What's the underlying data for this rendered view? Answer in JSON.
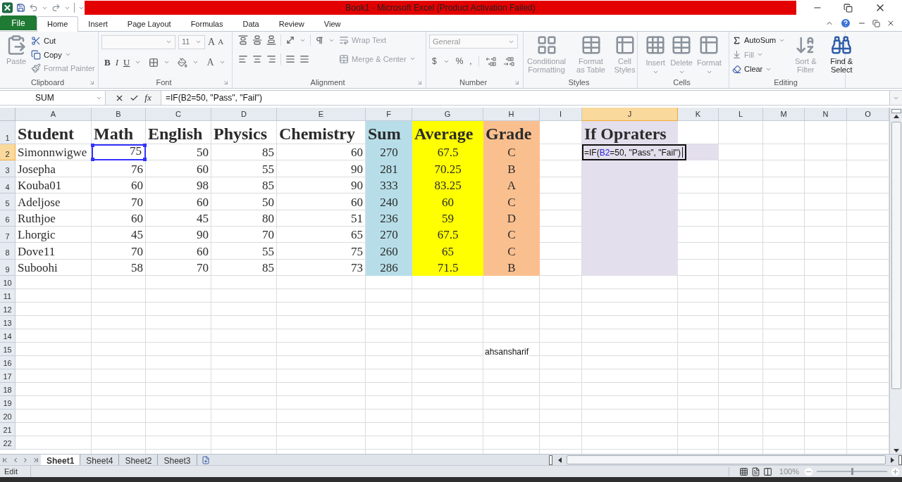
{
  "window": {
    "title": "Book1  -  Microsoft Excel (Product Activation Failed)"
  },
  "ribbon_tabs": [
    {
      "label": "File",
      "kind": "file",
      "selected": false
    },
    {
      "label": "Home",
      "kind": "tab",
      "selected": true
    },
    {
      "label": "Insert",
      "kind": "tab",
      "selected": false
    },
    {
      "label": "Page Layout",
      "kind": "tab",
      "selected": false
    },
    {
      "label": "Formulas",
      "kind": "tab",
      "selected": false
    },
    {
      "label": "Data",
      "kind": "tab",
      "selected": false
    },
    {
      "label": "Review",
      "kind": "tab",
      "selected": false
    },
    {
      "label": "View",
      "kind": "tab",
      "selected": false
    }
  ],
  "ribbon_groups": [
    {
      "kind": "clipboard",
      "label": "Clipboard",
      "commands": [
        {
          "label": "Paste",
          "disabled": true
        },
        {
          "label": "Cut",
          "disabled": false
        },
        {
          "label": "Copy",
          "disabled": false
        },
        {
          "label": "Format Painter",
          "disabled": true
        }
      ]
    },
    {
      "kind": "font",
      "label": "Font",
      "font_size": "11",
      "commands": [
        {
          "label": "B"
        },
        {
          "label": "I"
        },
        {
          "label": "U"
        }
      ],
      "grow_font": "A",
      "shrink_font": "A",
      "font_color": "A"
    },
    {
      "kind": "alignment",
      "label": "Alignment",
      "commands": [
        {
          "label": "Wrap Text",
          "disabled": true
        },
        {
          "label": "Merge & Center",
          "disabled": true
        }
      ]
    },
    {
      "kind": "number",
      "label": "Number",
      "format": "General",
      "symbols": [
        "$",
        "%",
        ","
      ]
    },
    {
      "kind": "styles",
      "label": "Styles",
      "commands": [
        {
          "label": "Conditional Formatting",
          "disabled": true
        },
        {
          "label": "Format as Table",
          "disabled": true
        },
        {
          "label": "Cell Styles",
          "disabled": true
        }
      ]
    },
    {
      "kind": "cells",
      "label": "Cells",
      "commands": [
        {
          "label": "Insert",
          "disabled": true
        },
        {
          "label": "Delete",
          "disabled": true
        },
        {
          "label": "Format",
          "disabled": true
        }
      ]
    },
    {
      "kind": "editing",
      "label": "Editing",
      "commands": [
        {
          "label": "AutoSum",
          "disabled": false
        },
        {
          "label": "Fill",
          "disabled": true
        },
        {
          "label": "Clear",
          "disabled": false
        },
        {
          "label": "Sort & Filter",
          "disabled": true
        },
        {
          "label": "Find & Select",
          "disabled": false
        }
      ]
    }
  ],
  "formula_bar": {
    "name_box": "SUM",
    "function_button": "fx",
    "formula": "=IF(B2=50, \"Pass\", \"Fail\")"
  },
  "sheet": {
    "columns": [
      {
        "label": "A",
        "selected": false
      },
      {
        "label": "B",
        "selected": false
      },
      {
        "label": "C",
        "selected": false
      },
      {
        "label": "D",
        "selected": false
      },
      {
        "label": "E",
        "selected": false
      },
      {
        "label": "F",
        "selected": false,
        "color": "#b7dee8"
      },
      {
        "label": "G",
        "selected": false,
        "color": "#ffff00"
      },
      {
        "label": "H",
        "selected": false,
        "color": "#fabf8f"
      },
      {
        "label": "I",
        "selected": false
      },
      {
        "label": "J",
        "selected": true,
        "color": "#e4dfec"
      },
      {
        "label": "K",
        "selected": false
      },
      {
        "label": "L",
        "selected": false
      },
      {
        "label": "M",
        "selected": false
      },
      {
        "label": "N",
        "selected": false
      },
      {
        "label": "O",
        "selected": false
      }
    ],
    "rows": [
      {
        "number": "1",
        "selected": false,
        "cells": [
          {
            "text": "Student",
            "referenced": false
          },
          {
            "text": "Math",
            "referenced": false
          },
          {
            "text": "English",
            "referenced": false
          },
          {
            "text": "Physics",
            "referenced": false
          },
          {
            "text": "Chemistry",
            "referenced": false
          },
          {
            "text": "Sum",
            "referenced": false
          },
          {
            "text": "Average",
            "referenced": false
          },
          {
            "text": "Grade",
            "referenced": false
          }
        ],
        "column_j": "If Opraters"
      },
      {
        "number": "2",
        "selected": true,
        "cells": [
          {
            "text": "Simonnwigwe",
            "referenced": false
          },
          {
            "text": "75",
            "referenced": true
          },
          {
            "text": "50",
            "referenced": false
          },
          {
            "text": "85",
            "referenced": false
          },
          {
            "text": "60",
            "referenced": false
          },
          {
            "text": "270",
            "referenced": false
          },
          {
            "text": "67.5",
            "referenced": false
          },
          {
            "text": "C",
            "referenced": false
          }
        ],
        "column_j_editing": {
          "before": "=IF(",
          "reference": "B2",
          "after": "=50, \"Pass\", \"Fail\")"
        }
      },
      {
        "number": "3",
        "selected": false,
        "cells": [
          {
            "text": "Josepha",
            "referenced": false
          },
          {
            "text": "76",
            "referenced": false
          },
          {
            "text": "60",
            "referenced": false
          },
          {
            "text": "55",
            "referenced": false
          },
          {
            "text": "90",
            "referenced": false
          },
          {
            "text": "281",
            "referenced": false
          },
          {
            "text": "70.25",
            "referenced": false
          },
          {
            "text": "B",
            "referenced": false
          }
        ]
      },
      {
        "number": "4",
        "selected": false,
        "cells": [
          {
            "text": "Kouba01",
            "referenced": false
          },
          {
            "text": "60",
            "referenced": false
          },
          {
            "text": "98",
            "referenced": false
          },
          {
            "text": "85",
            "referenced": false
          },
          {
            "text": "90",
            "referenced": false
          },
          {
            "text": "333",
            "referenced": false
          },
          {
            "text": "83.25",
            "referenced": false
          },
          {
            "text": "A",
            "referenced": false
          }
        ]
      },
      {
        "number": "5",
        "selected": false,
        "cells": [
          {
            "text": "Adeljose",
            "referenced": false
          },
          {
            "text": "70",
            "referenced": false
          },
          {
            "text": "60",
            "referenced": false
          },
          {
            "text": "50",
            "referenced": false
          },
          {
            "text": "60",
            "referenced": false
          },
          {
            "text": "240",
            "referenced": false
          },
          {
            "text": "60",
            "referenced": false
          },
          {
            "text": "C",
            "referenced": false
          }
        ]
      },
      {
        "number": "6",
        "selected": false,
        "cells": [
          {
            "text": "Ruthjoe",
            "referenced": false
          },
          {
            "text": "60",
            "referenced": false
          },
          {
            "text": "45",
            "referenced": false
          },
          {
            "text": "80",
            "referenced": false
          },
          {
            "text": "51",
            "referenced": false
          },
          {
            "text": "236",
            "referenced": false
          },
          {
            "text": "59",
            "referenced": false
          },
          {
            "text": "D",
            "referenced": false
          }
        ]
      },
      {
        "number": "7",
        "selected": false,
        "cells": [
          {
            "text": "Lhorgic",
            "referenced": false
          },
          {
            "text": "45",
            "referenced": false
          },
          {
            "text": "90",
            "referenced": false
          },
          {
            "text": "70",
            "referenced": false
          },
          {
            "text": "65",
            "referenced": false
          },
          {
            "text": "270",
            "referenced": false
          },
          {
            "text": "67.5",
            "referenced": false
          },
          {
            "text": "C",
            "referenced": false
          }
        ]
      },
      {
        "number": "8",
        "selected": false,
        "cells": [
          {
            "text": "Dove11",
            "referenced": false
          },
          {
            "text": "70",
            "referenced": false
          },
          {
            "text": "60",
            "referenced": false
          },
          {
            "text": "55",
            "referenced": false
          },
          {
            "text": "75",
            "referenced": false
          },
          {
            "text": "260",
            "referenced": false
          },
          {
            "text": "65",
            "referenced": false
          },
          {
            "text": "C",
            "referenced": false
          }
        ]
      },
      {
        "number": "9",
        "selected": false,
        "cells": [
          {
            "text": "Suboohi",
            "referenced": false
          },
          {
            "text": "58",
            "referenced": false
          },
          {
            "text": "70",
            "referenced": false
          },
          {
            "text": "85",
            "referenced": false
          },
          {
            "text": "73",
            "referenced": false
          },
          {
            "text": "286",
            "referenced": false
          },
          {
            "text": "71.5",
            "referenced": false
          },
          {
            "text": "B",
            "referenced": false
          }
        ]
      },
      {
        "number": "10",
        "selected": false
      },
      {
        "number": "11",
        "selected": false
      },
      {
        "number": "12",
        "selected": false
      },
      {
        "number": "13",
        "selected": false
      },
      {
        "number": "14",
        "selected": false
      },
      {
        "number": "15",
        "selected": false,
        "column_h": "ahsansharif"
      },
      {
        "number": "16",
        "selected": false
      },
      {
        "number": "17",
        "selected": false
      },
      {
        "number": "18",
        "selected": false
      },
      {
        "number": "19",
        "selected": false
      },
      {
        "number": "20",
        "selected": false
      },
      {
        "number": "21",
        "selected": false
      },
      {
        "number": "22",
        "selected": false
      }
    ]
  },
  "sheet_tabs": [
    {
      "label": "Sheet1",
      "selected": true
    },
    {
      "label": "Sheet4",
      "selected": false
    },
    {
      "label": "Sheet2",
      "selected": false
    },
    {
      "label": "Sheet3",
      "selected": false
    }
  ],
  "status_bar": {
    "mode": "Edit",
    "zoom": {
      "reading": "100%",
      "level": 0.5
    }
  }
}
